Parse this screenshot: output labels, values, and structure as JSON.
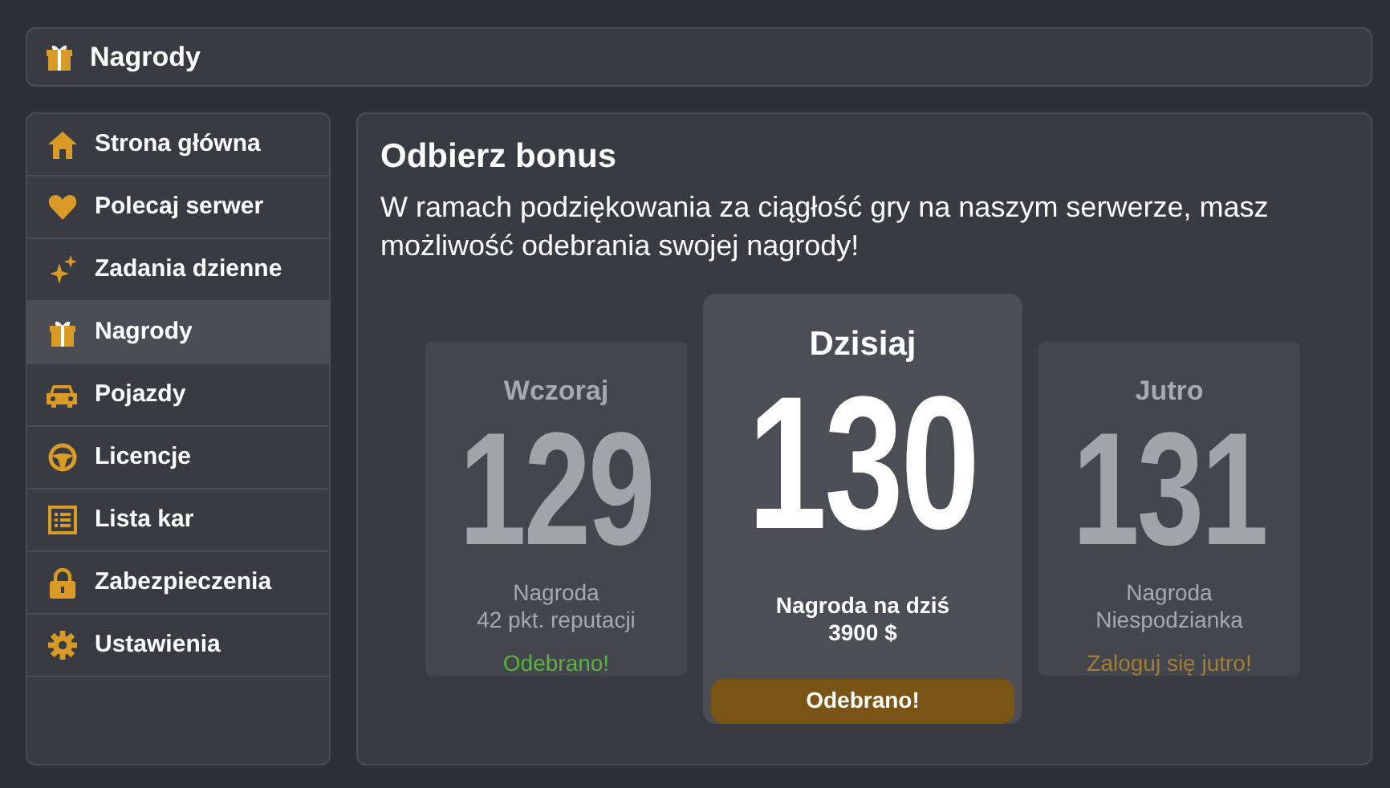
{
  "header": {
    "title": "Nagrody"
  },
  "sidebar": {
    "items": [
      {
        "label": "Strona główna",
        "selected": false
      },
      {
        "label": "Polecaj serwer",
        "selected": false
      },
      {
        "label": "Zadania dzienne",
        "selected": false
      },
      {
        "label": "Nagrody",
        "selected": true
      },
      {
        "label": "Pojazdy",
        "selected": false
      },
      {
        "label": "Licencje",
        "selected": false
      },
      {
        "label": "Lista kar",
        "selected": false
      },
      {
        "label": "Zabezpieczenia",
        "selected": false
      },
      {
        "label": "Ustawienia",
        "selected": false
      }
    ]
  },
  "content": {
    "title": "Odbierz bonus",
    "description": "W ramach podziękowania za ciągłość gry na naszym serwerze, masz możliwość odebrania swojej nagrody!",
    "cards": [
      {
        "kind": "past",
        "day": "Wczoraj",
        "number": "129",
        "reward_label": "Nagroda",
        "reward": "42 pkt. reputacji",
        "status": "Odebrano!"
      },
      {
        "kind": "today",
        "day": "Dzisiaj",
        "number": "130",
        "reward_label": "Nagroda na dziś",
        "reward": "3900 $",
        "status": "Odebrano!"
      },
      {
        "kind": "future",
        "day": "Jutro",
        "number": "131",
        "reward_label": "Nagroda",
        "reward": "Niespodzianka",
        "status": "Zaloguj się jutro!"
      }
    ]
  }
}
